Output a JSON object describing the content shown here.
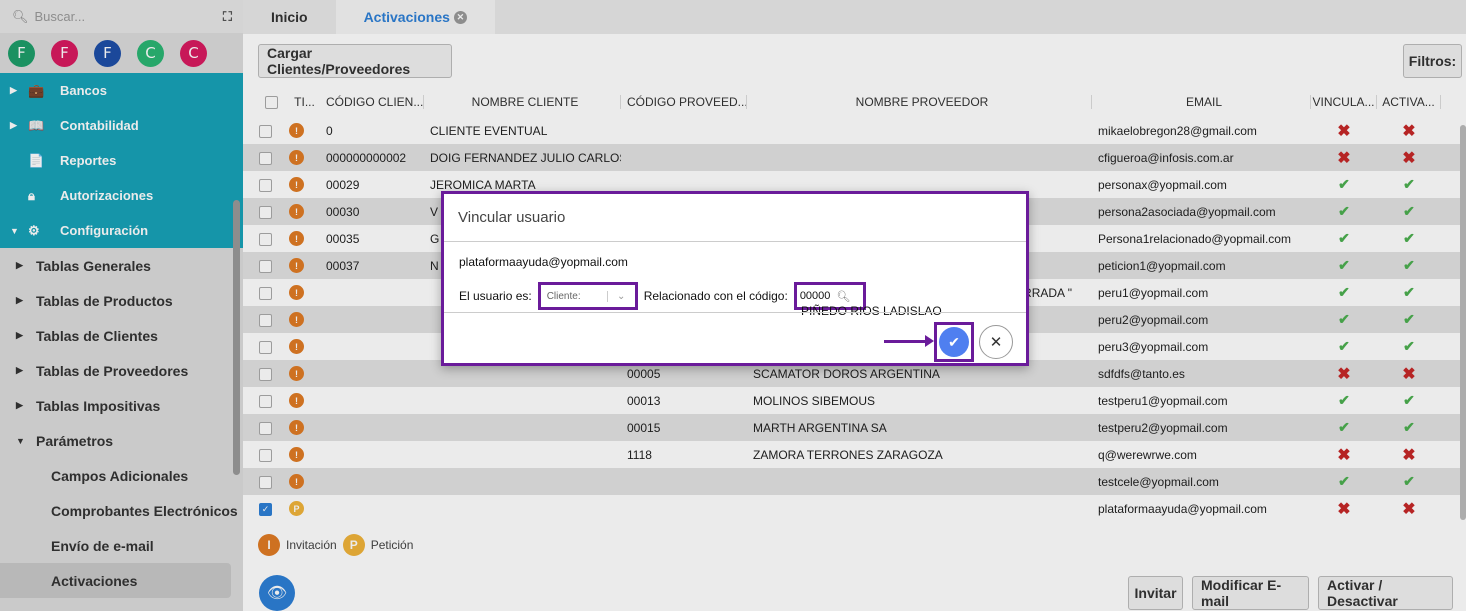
{
  "sidebar": {
    "search_placeholder": "Buscar...",
    "avatars": [
      {
        "letter": "F",
        "color": "#1e9e6a"
      },
      {
        "letter": "F",
        "color": "#d81b60"
      },
      {
        "letter": "F",
        "color": "#1e4fa8"
      },
      {
        "letter": "C",
        "color": "#2bb673"
      },
      {
        "letter": "C",
        "color": "#d81b60"
      }
    ],
    "teal_items": [
      "Bancos",
      "Contabilidad",
      "Reportes",
      "Autorizaciones",
      "Configuración"
    ],
    "items": [
      "Tablas Generales",
      "Tablas de Productos",
      "Tablas de Clientes",
      "Tablas de Proveedores",
      "Tablas Impositivas",
      "Parámetros"
    ],
    "sub_items": [
      "Campos Adicionales",
      "Comprobantes Electrónicos",
      "Envío de e-mail",
      "Activaciones"
    ]
  },
  "tabs": [
    "Inicio",
    "Activaciones"
  ],
  "toolbar": {
    "load_label": "Cargar Clientes/Proveedores",
    "filters_label": "Filtros:"
  },
  "table": {
    "headers": [
      "TI...",
      "CÓDIGO CLIEN...",
      "NOMBRE CLIENTE",
      "CÓDIGO PROVEED...",
      "NOMBRE PROVEEDOR",
      "EMAIL",
      "VINCULA...",
      "ACTIVA..."
    ],
    "rows": [
      {
        "type": "I",
        "cc": "0",
        "nc": "CLIENTE EVENTUAL",
        "cp": "",
        "np": "",
        "email": "mikaelobregon28@gmail.com",
        "v": false,
        "a": false
      },
      {
        "type": "I",
        "cc": "000000000002",
        "nc": "DOIG FERNANDEZ JULIO CARLOS",
        "cp": "",
        "np": "",
        "email": "cfigueroa@infosis.com.ar",
        "v": false,
        "a": false
      },
      {
        "type": "I",
        "cc": "00029",
        "nc": "JEROMICA MARTA",
        "cp": "",
        "np": "",
        "email": "personax@yopmail.com",
        "v": true,
        "a": true
      },
      {
        "type": "I",
        "cc": "00030",
        "nc": "V",
        "cp": "",
        "np": "",
        "email": "persona2asociada@yopmail.com",
        "v": true,
        "a": true
      },
      {
        "type": "I",
        "cc": "00035",
        "nc": "G",
        "cp": "",
        "np": "",
        "email": "Persona1relacionado@yopmail.com",
        "v": true,
        "a": true
      },
      {
        "type": "I",
        "cc": "00037",
        "nc": "N",
        "cp": "",
        "np": "",
        "email": "peticion1@yopmail.com",
        "v": true,
        "a": true
      },
      {
        "type": "I",
        "cc": "",
        "nc": "",
        "cp": "",
        "np": "ERRADA \"",
        "email": "peru1@yopmail.com",
        "v": true,
        "a": true
      },
      {
        "type": "I",
        "cc": "",
        "nc": "",
        "cp": "",
        "np": "",
        "email": "peru2@yopmail.com",
        "v": true,
        "a": true
      },
      {
        "type": "I",
        "cc": "",
        "nc": "",
        "cp": "",
        "np": "",
        "email": "peru3@yopmail.com",
        "v": true,
        "a": true
      },
      {
        "type": "I",
        "cc": "",
        "nc": "",
        "cp": "00005",
        "np": "SCAMATOR DOROS ARGENTINA",
        "email": "sdfdfs@tanto.es",
        "v": false,
        "a": false
      },
      {
        "type": "I",
        "cc": "",
        "nc": "",
        "cp": "00013",
        "np": "MOLINOS SIBEMOUS",
        "email": "testperu1@yopmail.com",
        "v": true,
        "a": true
      },
      {
        "type": "I",
        "cc": "",
        "nc": "",
        "cp": "00015",
        "np": "MARTH ARGENTINA SA",
        "email": "testperu2@yopmail.com",
        "v": true,
        "a": true
      },
      {
        "type": "I",
        "cc": "",
        "nc": "",
        "cp": "1118",
        "np": "ZAMORA TERRONES ZARAGOZA",
        "email": "q@werewrwe.com",
        "v": false,
        "a": false
      },
      {
        "type": "I",
        "cc": "",
        "nc": "",
        "cp": "",
        "np": "",
        "email": "testcele@yopmail.com",
        "v": true,
        "a": true
      },
      {
        "type": "P",
        "cc": "",
        "nc": "",
        "cp": "",
        "np": "",
        "email": "plataformaayuda@yopmail.com",
        "v": false,
        "a": false,
        "checked": true
      }
    ]
  },
  "legend": {
    "invitation_letter": "I",
    "invitation": "Invitación",
    "petition_letter": "P",
    "petition": "Petición"
  },
  "footer": {
    "invite": "Invitar",
    "modify_email": "Modificar E-mail",
    "toggle": "Activar / Desactivar"
  },
  "modal": {
    "title": "Vincular usuario",
    "email": "plataformaayuda@yopmail.com",
    "user_is_label": "El usuario es:",
    "user_type_value": "Cliente:",
    "related_label": "Relacionado con el código:",
    "code_value": "00000",
    "provider_name": "PIÑEDO RIOS LADISLAO"
  }
}
